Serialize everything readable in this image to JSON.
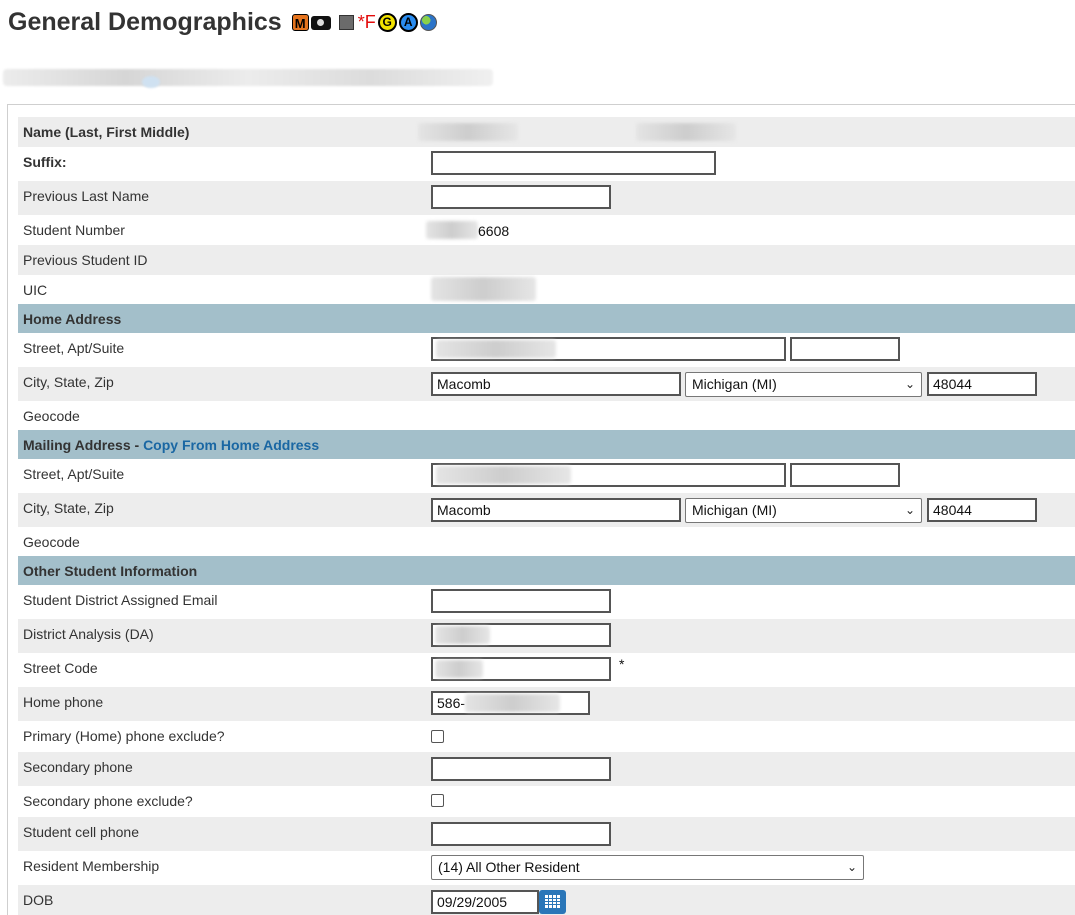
{
  "header": {
    "title": "General Demographics",
    "icons": [
      "m-badge-icon",
      "camera-icon",
      "pencil-icon",
      "alert-star-f-icon",
      "g-badge-icon",
      "a-badge-icon",
      "globe-icon"
    ],
    "badge_m": "M",
    "star_f": "*F",
    "badge_g": "G",
    "badge_a": "A"
  },
  "fields": {
    "name_label": "Name (Last, First Middle)",
    "suffix_label": "Suffix:",
    "previous_last_name_label": "Previous Last Name",
    "student_number_label": "Student Number",
    "student_number_value": "6608",
    "previous_student_id_label": "Previous Student ID",
    "uic_label": "UIC"
  },
  "home_address": {
    "section_title": "Home Address",
    "street_label": "Street, Apt/Suite",
    "city_state_zip_label": "City, State, Zip",
    "city": "Macomb",
    "state": "Michigan (MI)",
    "zip": "48044",
    "geocode_label": "Geocode"
  },
  "mailing_address": {
    "section_title": "Mailing Address - ",
    "copy_link": "Copy From Home Address",
    "street_label": "Street, Apt/Suite",
    "city_state_zip_label": "City, State, Zip",
    "city": "Macomb",
    "state": "Michigan (MI)",
    "zip": "48044",
    "geocode_label": "Geocode"
  },
  "other_info": {
    "section_title": "Other Student Information",
    "email_label": "Student District Assigned Email",
    "district_analysis_label": "District Analysis (DA)",
    "street_code_label": "Street Code",
    "street_code_required": "*",
    "home_phone_label": "Home phone",
    "home_phone_prefix": "586-",
    "primary_phone_exclude_label": "Primary (Home) phone exclude?",
    "secondary_phone_label": "Secondary phone",
    "secondary_phone_exclude_label": "Secondary phone exclude?",
    "cell_phone_label": "Student cell phone",
    "resident_membership_label": "Resident Membership",
    "resident_membership_value": "(14) All Other Resident",
    "dob_label": "DOB",
    "dob_value": "09/29/2005"
  },
  "colors": {
    "section_bg": "#a3bfca",
    "alt_row_bg": "#ededed",
    "link": "#1a67a3",
    "calendar_button": "#2a76b8"
  }
}
